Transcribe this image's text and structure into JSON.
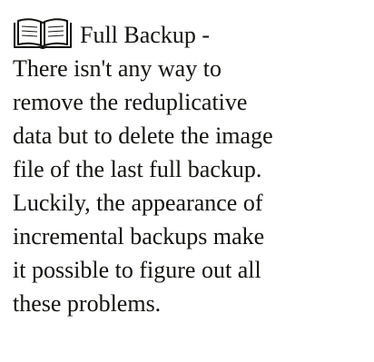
{
  "heading": {
    "icon": "open-book-icon",
    "title": "Full Backup -"
  },
  "body_lines": [
    "There isn't any way to",
    "remove the reduplicative",
    "data but to delete the image",
    "file of the last full backup.",
    "Luckily, the appearance of",
    "incremental backups make",
    "it possible to figure out all",
    "these problems."
  ],
  "colors": {
    "text": "#12120f",
    "background": "#ffffff"
  }
}
